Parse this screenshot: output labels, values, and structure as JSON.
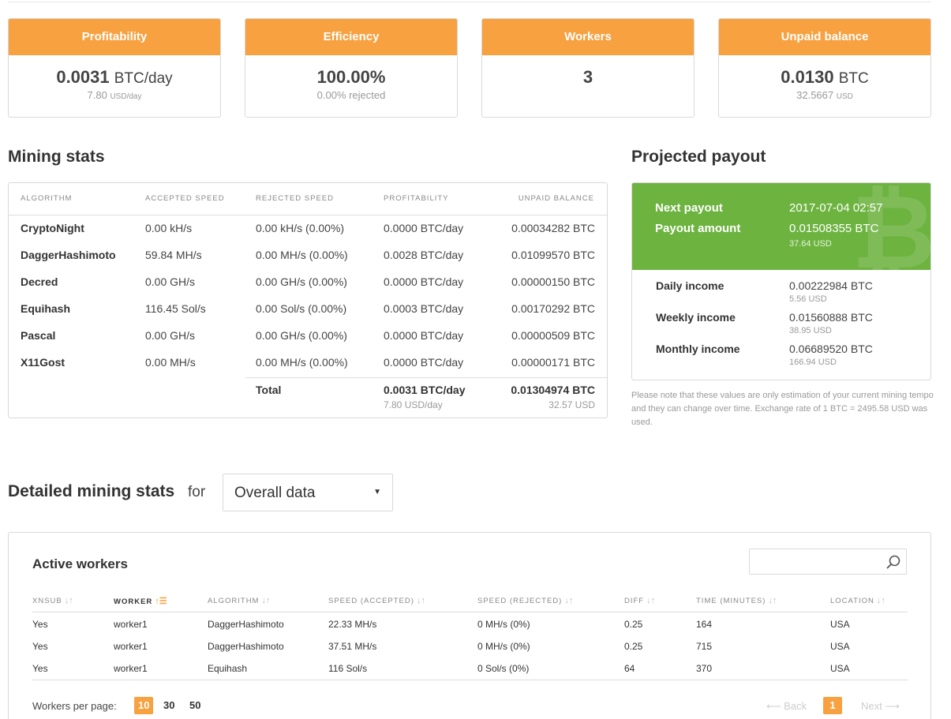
{
  "cards": [
    {
      "title": "Profitability",
      "value": "0.0031",
      "unit": "BTC/day",
      "sub_value": "7.80",
      "sub_unit": "USD/day"
    },
    {
      "title": "Efficiency",
      "value": "100.00%",
      "sub_value": "0.00% rejected"
    },
    {
      "title": "Workers",
      "value": "3"
    },
    {
      "title": "Unpaid balance",
      "value": "0.0130",
      "unit": "BTC",
      "sub_value": "32.5667",
      "sub_unit": "USD"
    }
  ],
  "mining_stats": {
    "title": "Mining stats",
    "headers": [
      "ALGORITHM",
      "ACCEPTED SPEED",
      "REJECTED SPEED",
      "PROFITABILITY",
      "UNPAID BALANCE"
    ],
    "rows": [
      {
        "algorithm": "CryptoNight",
        "accepted": "0.00 kH/s",
        "rejected": "0.00 kH/s (0.00%)",
        "profitability": "0.0000 BTC/day",
        "unpaid": "0.00034282 BTC"
      },
      {
        "algorithm": "DaggerHashimoto",
        "accepted": "59.84 MH/s",
        "rejected": "0.00 MH/s (0.00%)",
        "profitability": "0.0028 BTC/day",
        "unpaid": "0.01099570 BTC"
      },
      {
        "algorithm": "Decred",
        "accepted": "0.00 GH/s",
        "rejected": "0.00 GH/s (0.00%)",
        "profitability": "0.0000 BTC/day",
        "unpaid": "0.00000150 BTC"
      },
      {
        "algorithm": "Equihash",
        "accepted": "116.45 Sol/s",
        "rejected": "0.00 Sol/s (0.00%)",
        "profitability": "0.0003 BTC/day",
        "unpaid": "0.00170292 BTC"
      },
      {
        "algorithm": "Pascal",
        "accepted": "0.00 GH/s",
        "rejected": "0.00 GH/s (0.00%)",
        "profitability": "0.0000 BTC/day",
        "unpaid": "0.00000509 BTC"
      },
      {
        "algorithm": "X11Gost",
        "accepted": "0.00 MH/s",
        "rejected": "0.00 MH/s (0.00%)",
        "profitability": "0.0000 BTC/day",
        "unpaid": "0.00000171 BTC"
      }
    ],
    "total": {
      "label": "Total",
      "profitability": "0.0031 BTC/day",
      "profitability_usd": "7.80 USD/day",
      "unpaid": "0.01304974 BTC",
      "unpaid_usd": "32.57 USD"
    }
  },
  "projected_payout": {
    "title": "Projected payout",
    "next_payout_label": "Next payout",
    "next_payout_value": "2017-07-04 02:57",
    "payout_amount_label": "Payout amount",
    "payout_amount_value": "0.01508355 BTC",
    "payout_amount_usd": "37.64 USD",
    "income": [
      {
        "label": "Daily income",
        "btc": "0.00222984 BTC",
        "usd": "5.56 USD"
      },
      {
        "label": "Weekly income",
        "btc": "0.01560888 BTC",
        "usd": "38.95 USD"
      },
      {
        "label": "Monthly income",
        "btc": "0.06689520 BTC",
        "usd": "166.94 USD"
      }
    ],
    "note": "Please note that these values are only estimation of your current mining tempo and they can change over time. Exchange rate of 1 BTC = 2495.58 USD was used."
  },
  "detailed": {
    "title": "Detailed mining stats",
    "for_label": "for",
    "select_value": "Overall data"
  },
  "active_workers": {
    "title": "Active workers",
    "search_value": "",
    "headers": [
      "XNSUB",
      "WORKER",
      "ALGORITHM",
      "SPEED (ACCEPTED)",
      "SPEED (REJECTED)",
      "DIFF",
      "TIME (MINUTES)",
      "LOCATION"
    ],
    "rows": [
      {
        "xnsub": "Yes",
        "worker": "worker1",
        "algorithm": "DaggerHashimoto",
        "speed_accepted": "22.33 MH/s",
        "speed_rejected": "0 MH/s (0%)",
        "diff": "0.25",
        "time": "164",
        "location": "USA"
      },
      {
        "xnsub": "Yes",
        "worker": "worker1",
        "algorithm": "DaggerHashimoto",
        "speed_accepted": "37.51 MH/s",
        "speed_rejected": "0 MH/s (0%)",
        "diff": "0.25",
        "time": "715",
        "location": "USA"
      },
      {
        "xnsub": "Yes",
        "worker": "worker1",
        "algorithm": "Equihash",
        "speed_accepted": "116 Sol/s",
        "speed_rejected": "0 Sol/s (0%)",
        "diff": "64",
        "time": "370",
        "location": "USA"
      }
    ],
    "per_page_label": "Workers per page:",
    "per_page_options": [
      "10",
      "30",
      "50"
    ],
    "per_page_selected": "10",
    "pagination": {
      "back": "⟵ Back",
      "page": "1",
      "next": "Next ⟶"
    }
  },
  "colors": {
    "accent": "#f7a140",
    "payout_green": "#6db33f"
  }
}
